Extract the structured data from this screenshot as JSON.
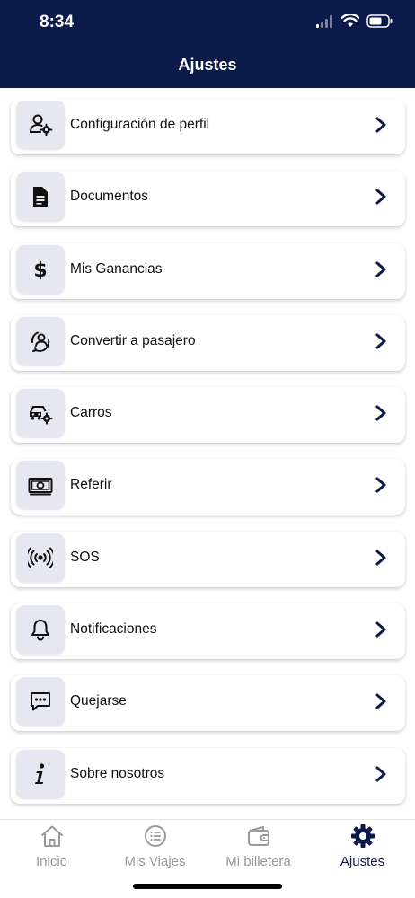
{
  "status_bar": {
    "time": "8:34"
  },
  "header": {
    "title": "Ajustes"
  },
  "menu": {
    "items": [
      {
        "label": "Configuración de perfil",
        "icon": "user-settings-icon"
      },
      {
        "label": "Documentos",
        "icon": "document-icon"
      },
      {
        "label": "Mis Ganancias",
        "icon": "dollar-icon"
      },
      {
        "label": "Convertir a pasajero",
        "icon": "convert-passenger-icon"
      },
      {
        "label": "Carros",
        "icon": "car-settings-icon"
      },
      {
        "label": "Referir",
        "icon": "money-icon"
      },
      {
        "label": "SOS",
        "icon": "broadcast-icon"
      },
      {
        "label": "Notificaciones",
        "icon": "bell-icon"
      },
      {
        "label": "Quejarse",
        "icon": "chat-icon"
      },
      {
        "label": "Sobre nosotros",
        "icon": "info-icon"
      }
    ]
  },
  "tabbar": {
    "tabs": [
      {
        "label": "Inicio",
        "icon": "home-icon",
        "active": false
      },
      {
        "label": "Mis Viajes",
        "icon": "list-icon",
        "active": false
      },
      {
        "label": "Mi billetera",
        "icon": "wallet-icon",
        "active": false
      },
      {
        "label": "Ajustes",
        "icon": "gear-icon",
        "active": true
      }
    ]
  },
  "colors": {
    "header_bg": "#0c1a4a",
    "icon_box_bg": "#e7e7f1",
    "accent": "#0c1a4a",
    "tab_inactive": "#9a9a9a"
  }
}
